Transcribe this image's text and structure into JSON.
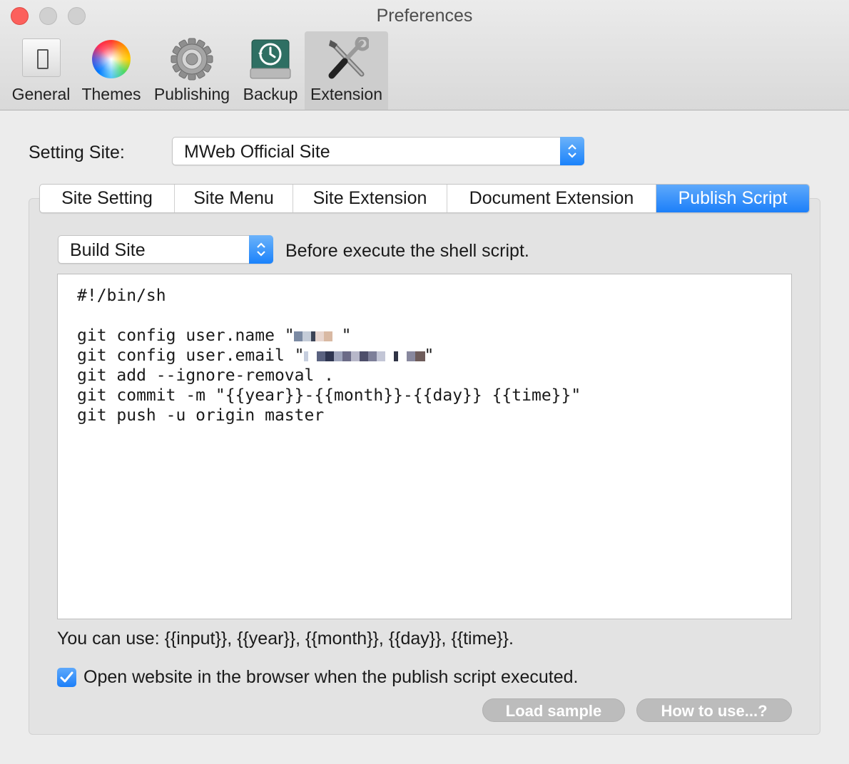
{
  "window": {
    "title": "Preferences"
  },
  "toolbar": {
    "items": [
      {
        "label": "General",
        "icon": "general-icon"
      },
      {
        "label": "Themes",
        "icon": "themes-icon"
      },
      {
        "label": "Publishing",
        "icon": "gear-icon"
      },
      {
        "label": "Backup",
        "icon": "backup-icon"
      },
      {
        "label": "Extension",
        "icon": "tools-icon",
        "active": true
      }
    ]
  },
  "setting_site": {
    "label": "Setting Site:",
    "value": "MWeb Official Site"
  },
  "tabs": [
    {
      "label": "Site Setting"
    },
    {
      "label": "Site Menu"
    },
    {
      "label": "Site Extension"
    },
    {
      "label": "Document Extension"
    },
    {
      "label": "Publish Script",
      "selected": true
    }
  ],
  "script": {
    "trigger_value": "Build Site",
    "trigger_desc": "Before execute the shell script.",
    "lines": [
      "#!/bin/sh",
      "",
      "git config user.name \"",
      "git config user.email \"",
      "git add --ignore-removal .",
      "git commit -m \"{{year}}-{{month}}-{{day}} {{time}}\"",
      "git push -u origin master"
    ],
    "hint": "You can use: {{input}}, {{year}}, {{month}}, {{day}}, {{time}}.",
    "open_browser_label": "Open website in the browser when the publish script executed.",
    "open_browser_checked": true
  },
  "buttons": {
    "load_sample": "Load sample",
    "how_to_use": "How to use...?"
  },
  "colors": {
    "accent": "#1c7ff9",
    "close": "#fc605c"
  }
}
